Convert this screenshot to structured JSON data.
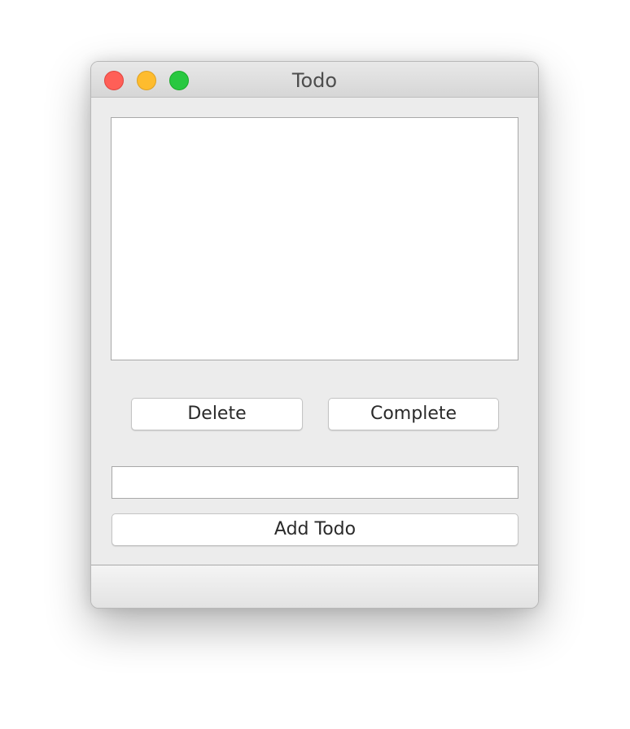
{
  "window": {
    "title": "Todo",
    "traffic_lights": {
      "close_color": "#ff5f57",
      "minimize_color": "#febc2e",
      "maximize_color": "#28c840"
    }
  },
  "todo_list": {
    "items": []
  },
  "buttons": {
    "delete_label": "Delete",
    "complete_label": "Complete",
    "add_label": "Add Todo"
  },
  "new_todo_input": {
    "value": "",
    "placeholder": ""
  }
}
